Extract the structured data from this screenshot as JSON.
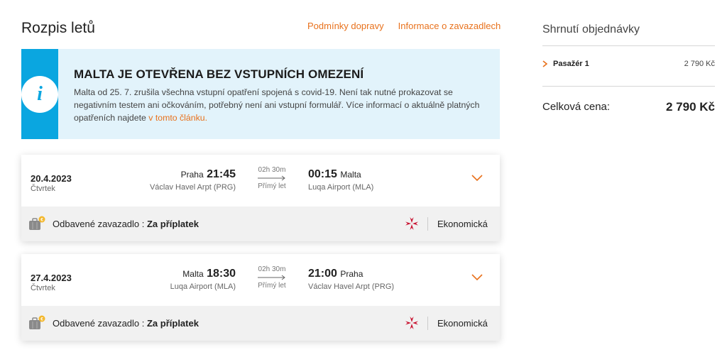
{
  "page_title": "Rozpis letů",
  "links": {
    "conditions": "Podmínky dopravy",
    "baggage": "Informace o zavazadlech"
  },
  "info_box": {
    "title": "MALTA JE OTEVŘENA BEZ VSTUPNÍCH OMEZENÍ",
    "body": "Malta od 25. 7. zrušila všechna vstupní opatření spojená s covid-19. Není tak nutné prokazovat se negativním testem ani očkováním, potřebný není ani vstupní formulář. Více informací o aktuálně platných opatřeních najdete ",
    "link_text": "v tomto článku.",
    "icon": "info-icon"
  },
  "flights": [
    {
      "date": "20.4.2023",
      "weekday": "Čtvrtek",
      "dep_city": "Praha",
      "dep_time": "21:45",
      "dep_airport": "Václav Havel Arpt (PRG)",
      "duration": "02h 30m",
      "stops": "Přímý let",
      "arr_time": "00:15",
      "arr_city": "Malta",
      "arr_airport": "Luqa Airport (MLA)",
      "baggage_label": "Odbavené zavazadlo : ",
      "baggage_value": "Za příplatek",
      "cabin": "Ekonomická"
    },
    {
      "date": "27.4.2023",
      "weekday": "Čtvrtek",
      "dep_city": "Malta",
      "dep_time": "18:30",
      "dep_airport": "Luqa Airport (MLA)",
      "duration": "02h 30m",
      "stops": "Přímý let",
      "arr_time": "21:00",
      "arr_city": "Praha",
      "arr_airport": "Václav Havel Arpt (PRG)",
      "baggage_label": "Odbavené zavazadlo : ",
      "baggage_value": "Za příplatek",
      "cabin": "Ekonomická"
    }
  ],
  "summary": {
    "title": "Shrnutí objednávky",
    "passenger_label": "Pasažér 1",
    "passenger_price": "2 790 Kč",
    "total_label": "Celková cena:",
    "total_price": "2 790 Kč"
  },
  "colors": {
    "accent": "#e8711c",
    "info_blue": "#0aa6e0",
    "info_bg": "#e2f3fb",
    "airline_red": "#c8102e"
  }
}
